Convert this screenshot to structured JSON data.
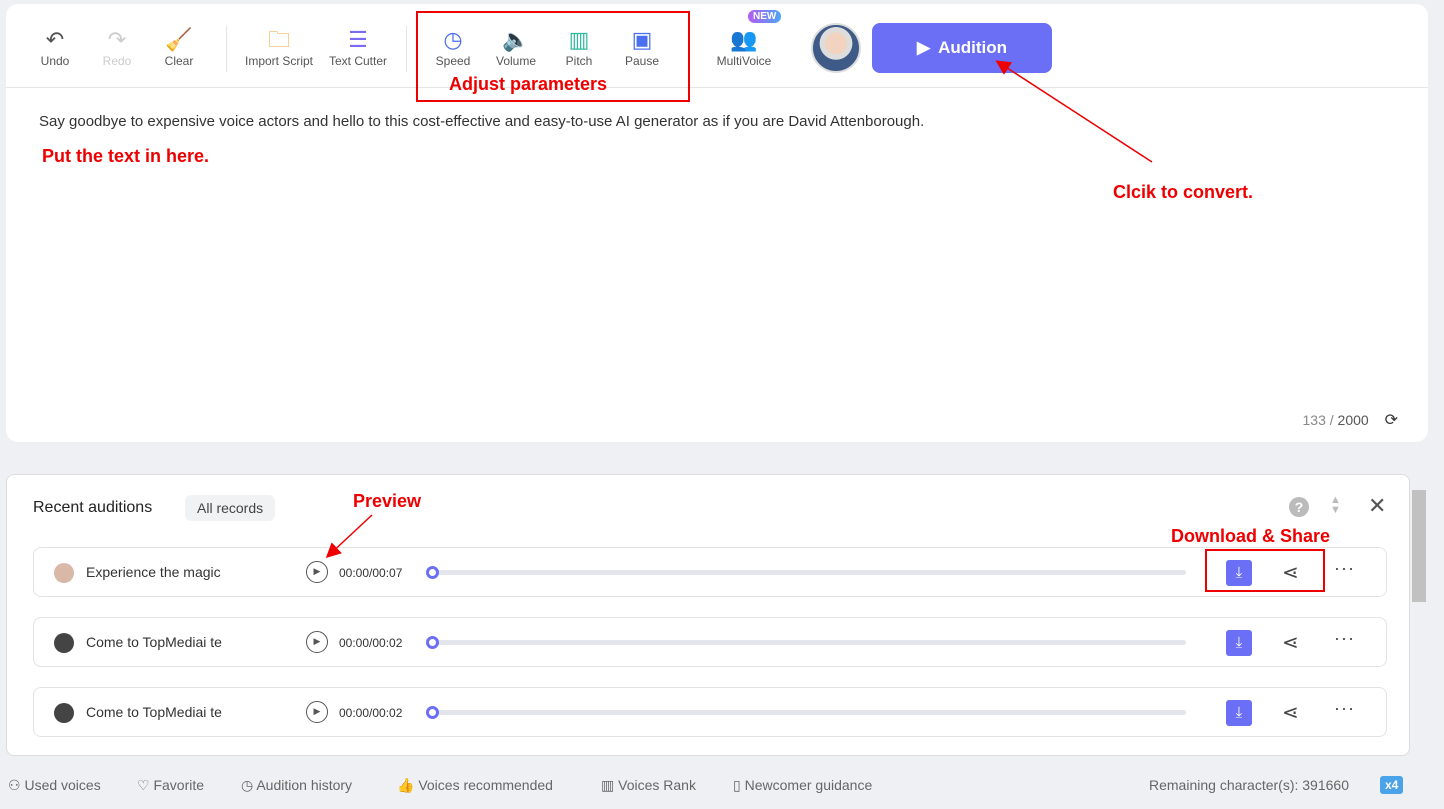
{
  "toolbar": {
    "undo": "Undo",
    "redo": "Redo",
    "clear": "Clear",
    "import": "Import Script",
    "cutter": "Text Cutter",
    "speed": "Speed",
    "volume": "Volume",
    "pitch": "Pitch",
    "pause": "Pause",
    "multivoice": "MultiVoice",
    "new_badge": "NEW",
    "audition": "Audition"
  },
  "editor": {
    "text": "Say goodbye to expensive voice actors and hello to this cost-effective and easy-to-use AI generator as if you are David Attenborough.",
    "count": "133",
    "max": "2000"
  },
  "annotations": {
    "params": "Adjust parameters",
    "text": "Put the text in here.",
    "convert": "Clcik to convert.",
    "preview": "Preview",
    "download": "Download & Share"
  },
  "recent": {
    "title": "Recent auditions",
    "all": "All records",
    "rows": [
      {
        "name": "Experience the magic",
        "time": "00:00/00:07"
      },
      {
        "name": "Come to TopMediai te",
        "time": "00:00/00:02"
      },
      {
        "name": "Come to TopMediai te",
        "time": "00:00/00:02"
      }
    ]
  },
  "footer": {
    "used": "Used voices",
    "favorite": "Favorite",
    "history": "Audition history",
    "recommended": "Voices recommended",
    "rank": "Voices Rank",
    "guidance": "Newcomer guidance",
    "remaining": "Remaining character(s): 391660",
    "multiplier": "x4"
  },
  "colors": {
    "accent": "#6b6ff5",
    "annotation": "#e00000"
  }
}
